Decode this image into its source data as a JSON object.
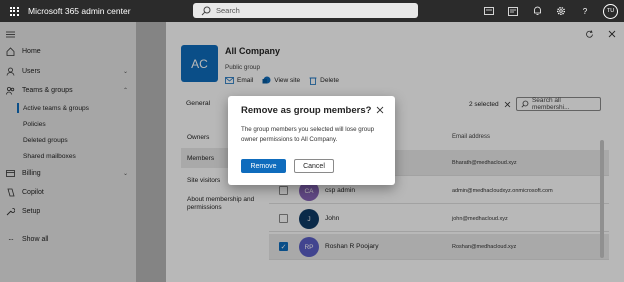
{
  "header": {
    "app_title": "Microsoft 365 admin center",
    "search_placeholder": "Search",
    "user_initials": "TU"
  },
  "nav": {
    "items": [
      {
        "label": "Home",
        "icon": "home-icon"
      },
      {
        "label": "Users",
        "icon": "user-icon"
      },
      {
        "label": "Teams & groups",
        "icon": "teams-icon"
      },
      {
        "label": "Billing",
        "icon": "billing-icon"
      },
      {
        "label": "Copilot",
        "icon": "copilot-icon"
      },
      {
        "label": "Setup",
        "icon": "setup-icon"
      },
      {
        "label": "Show all",
        "icon": "ellipsis-icon"
      }
    ],
    "teams_sub": [
      "Active teams & groups",
      "Policies",
      "Deleted groups",
      "Shared mailboxes"
    ]
  },
  "panel": {
    "group_initials": "AC",
    "group_name": "All Company",
    "group_type": "Public group",
    "actions": [
      "Email",
      "View site",
      "Delete"
    ],
    "tabs": [
      "General",
      "M",
      "ber"
    ],
    "selected_count": "2 selected",
    "search_placeholder": "Search all membershi...",
    "subnav": [
      "Owners",
      "Members",
      "Site visitors",
      "About membership and permissions"
    ],
    "columns": {
      "email": "Email address"
    },
    "rows": [
      {
        "initials": "",
        "name": "",
        "email": "Bharath@medhacloud.xyz",
        "selected": true,
        "color": "#6a6a6a"
      },
      {
        "initials": "CA",
        "name": "csp admin",
        "email": "admin@medhacloudxyz.onmicrosoft.com",
        "selected": false,
        "color": "#8764b8"
      },
      {
        "initials": "J",
        "name": "John",
        "email": "john@medhacloud.xyz",
        "selected": false,
        "color": "#0f3b66"
      },
      {
        "initials": "RP",
        "name": "Roshan R Poojary",
        "email": "Roshan@medhacloud.xyz",
        "selected": true,
        "color": "#5b5fc7"
      }
    ]
  },
  "dialog": {
    "title": "Remove as group members?",
    "body": "The group members you selected will lose group owner permissions to All Company.",
    "primary": "Remove",
    "secondary": "Cancel"
  },
  "colors": {
    "accent": "#0f6cbd",
    "topbar": "#2b2b2b"
  }
}
